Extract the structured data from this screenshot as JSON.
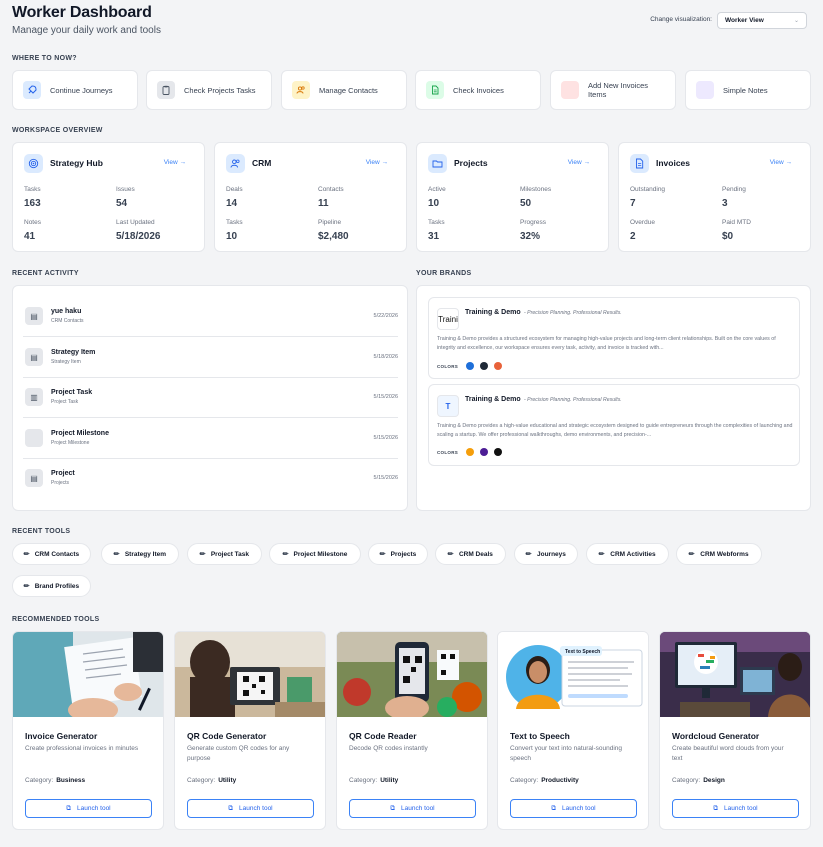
{
  "header": {
    "title": "Worker Dashboard",
    "subtitle": "Manage your daily work and tools",
    "viz_label": "Change visualization:",
    "viz_value": "Worker View"
  },
  "sections": {
    "where": "WHERE TO NOW?",
    "overview": "WORKSPACE OVERVIEW",
    "activity": "RECENT ACTIVITY",
    "brands": "YOUR BRANDS",
    "recent_tools": "RECENT TOOLS",
    "recommended": "RECOMMENDED TOOLS"
  },
  "quick_actions": [
    {
      "label": "Continue Journeys",
      "icon": "rocket-icon",
      "color": "#dbeafe"
    },
    {
      "label": "Check Projects Tasks",
      "icon": "clipboard-icon",
      "color": "#e5e7eb"
    },
    {
      "label": "Manage Contacts",
      "icon": "users-icon",
      "color": "#fef3c7"
    },
    {
      "label": "Check Invoices",
      "icon": "document-icon",
      "color": "#dcfce7"
    },
    {
      "label": "Add New Invoices Items",
      "icon": "blank-icon",
      "color": "#fee2e2"
    },
    {
      "label": "Simple Notes",
      "icon": "blank-icon",
      "color": "#ede9fe"
    }
  ],
  "overview": [
    {
      "name": "Strategy Hub",
      "view": "View →",
      "stats": [
        {
          "label": "Tasks",
          "value": "163"
        },
        {
          "label": "Issues",
          "value": "54"
        },
        {
          "label": "Notes",
          "value": "41"
        },
        {
          "label": "Last Updated",
          "value": "5/18/2026"
        }
      ]
    },
    {
      "name": "CRM",
      "view": "View →",
      "stats": [
        {
          "label": "Deals",
          "value": "14"
        },
        {
          "label": "Contacts",
          "value": "11"
        },
        {
          "label": "Tasks",
          "value": "10"
        },
        {
          "label": "Pipeline",
          "value": "$2,480"
        }
      ]
    },
    {
      "name": "Projects",
      "view": "View →",
      "stats": [
        {
          "label": "Active",
          "value": "10"
        },
        {
          "label": "Milestones",
          "value": "50"
        },
        {
          "label": "Tasks",
          "value": "31"
        },
        {
          "label": "Progress",
          "value": "32%"
        }
      ]
    },
    {
      "name": "Invoices",
      "view": "View →",
      "stats": [
        {
          "label": "Outstanding",
          "value": "7"
        },
        {
          "label": "Pending",
          "value": "3"
        },
        {
          "label": "Overdue",
          "value": "2"
        },
        {
          "label": "Paid MTD",
          "value": "$0"
        }
      ]
    }
  ],
  "activity": [
    {
      "title": "yue haku",
      "sub": "CRM Contacts",
      "date": "5/22/2026"
    },
    {
      "title": "Strategy Item",
      "sub": "Strategy Item",
      "date": "5/18/2026"
    },
    {
      "title": "Project Task",
      "sub": "Project Task",
      "date": "5/15/2026"
    },
    {
      "title": "Project Milestone",
      "sub": "Project Milestone",
      "date": "5/15/2026"
    },
    {
      "title": "Project",
      "sub": "Projects",
      "date": "5/15/2026"
    }
  ],
  "brands": [
    {
      "name": "Training & Demo",
      "tagline": "- Precision Planning. Professional Results.",
      "logo": "Traini",
      "description": "Training & Demo provides a structured ecosystem for managing high-value projects and long-term client relationships. Built on the core values of integrity and excellence, our workspace ensures every task, activity, and invoice is tracked with...",
      "colors_label": "COLORS",
      "colors": [
        "#1e6fd9",
        "#1f2937",
        "#e8623a"
      ]
    },
    {
      "name": "Training & Demo",
      "tagline": "- Precision Planning. Professional Results.",
      "logo": "T",
      "description": "Training & Demo provides a high-value educational and strategic ecosystem designed to guide entrepreneurs through the complexities of launching and scaling a startup. We offer professional walkthroughs, demo environments, and precision-...",
      "colors_label": "COLORS",
      "colors": [
        "#f59e0b",
        "#4c1d95",
        "#111111"
      ]
    }
  ],
  "recent_tools": [
    "CRM Contacts",
    "Strategy Item",
    "Project Task",
    "Project Milestone",
    "Projects",
    "CRM Deals",
    "Journeys",
    "CRM Activities",
    "CRM Webforms",
    "Brand Profiles"
  ],
  "tools": [
    {
      "name": "Invoice Generator",
      "desc": "Create professional invoices in minutes",
      "category_label": "Category:",
      "category": "Business",
      "launch": "Launch tool"
    },
    {
      "name": "QR Code Generator",
      "desc": "Generate custom QR codes for any purpose",
      "category_label": "Category:",
      "category": "Utility",
      "launch": "Launch tool"
    },
    {
      "name": "QR Code Reader",
      "desc": "Decode QR codes instantly",
      "category_label": "Category:",
      "category": "Utility",
      "launch": "Launch tool"
    },
    {
      "name": "Text to Speech",
      "desc": "Convert your text into natural-sounding speech",
      "category_label": "Category:",
      "category": "Productivity",
      "launch": "Launch tool",
      "badge": "Text to Speech"
    },
    {
      "name": "Wordcloud Generator",
      "desc": "Create beautiful word clouds from your text",
      "category_label": "Category:",
      "category": "Design",
      "launch": "Launch tool"
    }
  ]
}
